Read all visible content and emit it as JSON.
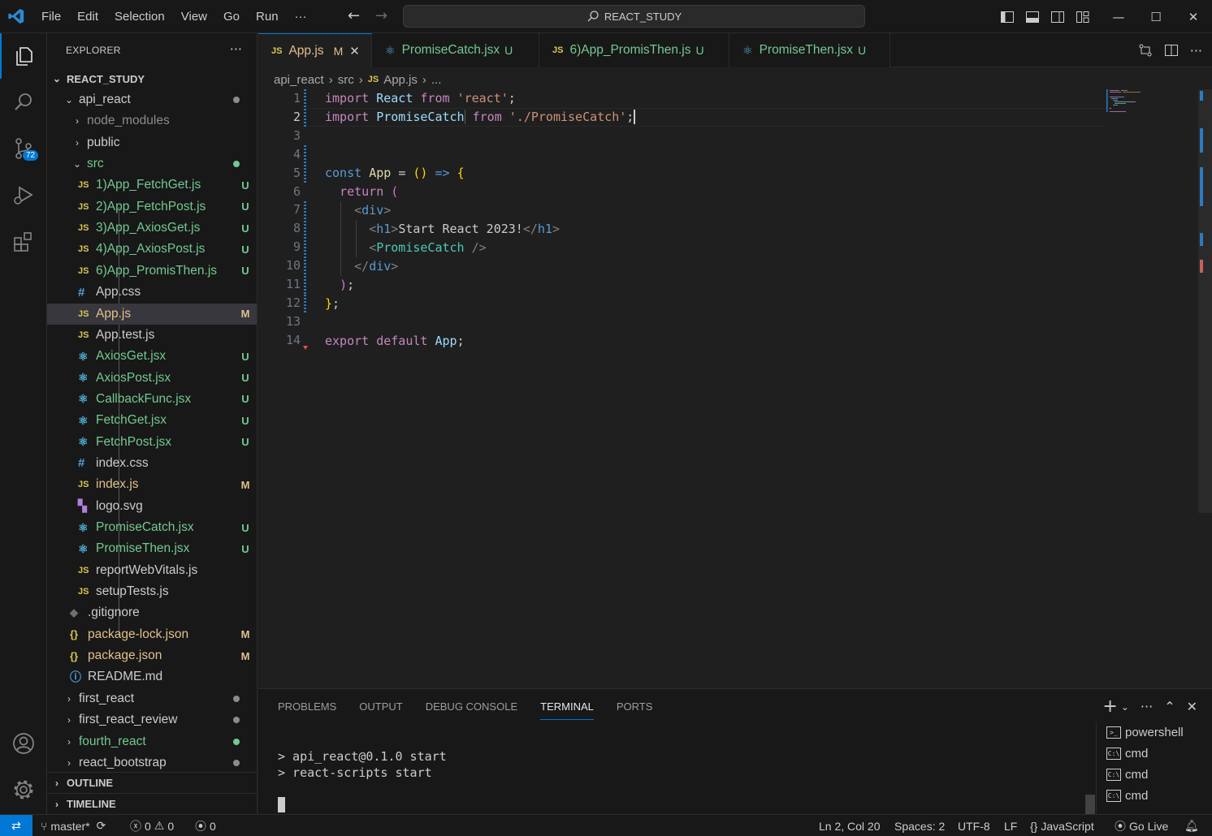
{
  "titlebar": {
    "menu": [
      "File",
      "Edit",
      "Selection",
      "View",
      "Go",
      "Run",
      "···"
    ],
    "search": "REACT_STUDY"
  },
  "activity": {
    "scm_badge": "72"
  },
  "explorer": {
    "header": "EXPLORER",
    "root": "REACT_STUDY",
    "items": [
      {
        "name": "api_react",
        "type": "folder-open",
        "level": 1,
        "status": "dot",
        "dot_color": "#8c8c8c"
      },
      {
        "name": "node_modules",
        "type": "folder",
        "level": 2,
        "style": "dim"
      },
      {
        "name": "public",
        "type": "folder",
        "level": 2
      },
      {
        "name": "src",
        "type": "folder-open",
        "level": 2,
        "style": "u",
        "status": "dot",
        "dot_color": "#73c991"
      },
      {
        "name": "1)App_FetchGet.js",
        "type": "js",
        "level": 3,
        "style": "u",
        "status": "U"
      },
      {
        "name": "2)App_FetchPost.js",
        "type": "js",
        "level": 3,
        "style": "u",
        "status": "U"
      },
      {
        "name": "3)App_AxiosGet.js",
        "type": "js",
        "level": 3,
        "style": "u",
        "status": "U"
      },
      {
        "name": "4)App_AxiosPost.js",
        "type": "js",
        "level": 3,
        "style": "u",
        "status": "U"
      },
      {
        "name": "6)App_PromisThen.js",
        "type": "js",
        "level": 3,
        "style": "u",
        "status": "U"
      },
      {
        "name": "App.css",
        "type": "css",
        "level": 3
      },
      {
        "name": "App.js",
        "type": "js",
        "level": 3,
        "style": "m",
        "status": "M",
        "selected": true
      },
      {
        "name": "App.test.js",
        "type": "js",
        "level": 3
      },
      {
        "name": "AxiosGet.jsx",
        "type": "react",
        "level": 3,
        "style": "u",
        "status": "U"
      },
      {
        "name": "AxiosPost.jsx",
        "type": "react",
        "level": 3,
        "style": "u",
        "status": "U"
      },
      {
        "name": "CallbackFunc.jsx",
        "type": "react",
        "level": 3,
        "style": "u",
        "status": "U"
      },
      {
        "name": "FetchGet.jsx",
        "type": "react",
        "level": 3,
        "style": "u",
        "status": "U"
      },
      {
        "name": "FetchPost.jsx",
        "type": "react",
        "level": 3,
        "style": "u",
        "status": "U"
      },
      {
        "name": "index.css",
        "type": "css",
        "level": 3
      },
      {
        "name": "index.js",
        "type": "js",
        "level": 3,
        "style": "m",
        "status": "M"
      },
      {
        "name": "logo.svg",
        "type": "svg",
        "level": 3
      },
      {
        "name": "PromiseCatch.jsx",
        "type": "react",
        "level": 3,
        "style": "u",
        "status": "U"
      },
      {
        "name": "PromiseThen.jsx",
        "type": "react",
        "level": 3,
        "style": "u",
        "status": "U"
      },
      {
        "name": "reportWebVitals.js",
        "type": "js",
        "level": 3
      },
      {
        "name": "setupTests.js",
        "type": "js",
        "level": 3
      },
      {
        "name": ".gitignore",
        "type": "git",
        "level": 2
      },
      {
        "name": "package-lock.json",
        "type": "json",
        "level": 2,
        "style": "m",
        "status": "M"
      },
      {
        "name": "package.json",
        "type": "json",
        "level": 2,
        "style": "m",
        "status": "M"
      },
      {
        "name": "README.md",
        "type": "info",
        "level": 2
      },
      {
        "name": "first_react",
        "type": "folder",
        "level": 1,
        "status": "dot",
        "dot_color": "#8c8c8c"
      },
      {
        "name": "first_react_review",
        "type": "folder",
        "level": 1,
        "status": "dot",
        "dot_color": "#8c8c8c"
      },
      {
        "name": "fourth_react",
        "type": "folder",
        "level": 1,
        "style": "u",
        "status": "dot",
        "dot_color": "#73c991"
      },
      {
        "name": "react_bootstrap",
        "type": "folder",
        "level": 1,
        "status": "dot",
        "dot_color": "#8c8c8c"
      }
    ],
    "outline": "OUTLINE",
    "timeline": "TIMELINE"
  },
  "tabs": [
    {
      "label": "App.js",
      "type": "js",
      "status": "M",
      "style": "m",
      "active": true
    },
    {
      "label": "PromiseCatch.jsx",
      "type": "react",
      "status": "U",
      "style": "u"
    },
    {
      "label": "6)App_PromisThen.js",
      "type": "js",
      "status": "U",
      "style": "u"
    },
    {
      "label": "PromiseThen.jsx",
      "type": "react",
      "status": "U",
      "style": "u"
    }
  ],
  "breadcrumb": {
    "parts": [
      "api_react",
      "src",
      "App.js",
      "..."
    ]
  },
  "editor": {
    "line_numbers": [
      "1",
      "2",
      "3",
      "4",
      "5",
      "6",
      "7",
      "8",
      "9",
      "10",
      "11",
      "12",
      "13",
      "14"
    ],
    "current_line": 2
  },
  "panel": {
    "tabs": [
      "PROBLEMS",
      "OUTPUT",
      "DEBUG CONSOLE",
      "TERMINAL",
      "PORTS"
    ],
    "active_tab": "TERMINAL",
    "terminal_lines": [
      "> api_react@0.1.0 start",
      "> react-scripts start"
    ],
    "terminals": [
      "powershell",
      "cmd",
      "cmd",
      "cmd"
    ]
  },
  "statusbar": {
    "branch": "master*",
    "errors": "0",
    "warnings": "0",
    "ports": "0",
    "position": "Ln 2, Col 20",
    "spaces": "Spaces: 2",
    "encoding": "UTF-8",
    "eol": "LF",
    "language": "JavaScript",
    "golive": "Go Live"
  }
}
